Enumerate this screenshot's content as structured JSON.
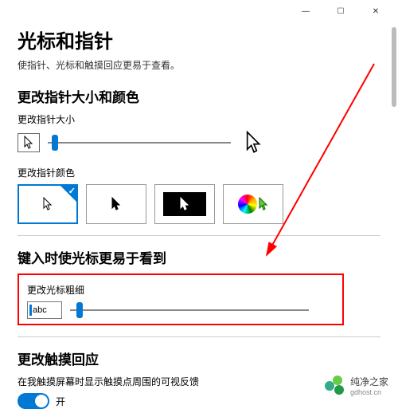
{
  "titlebar": {
    "min": "—",
    "max": "☐",
    "close": "✕"
  },
  "page": {
    "title": "光标和指针",
    "subtitle": "使指针、光标和触摸回应更易于查看。"
  },
  "pointer": {
    "section": "更改指针大小和颜色",
    "size_label": "更改指针大小",
    "color_label": "更改指针颜色"
  },
  "caret": {
    "section": "键入时使光标更易于看到",
    "thickness_label": "更改光标粗细",
    "preview_text": "abc"
  },
  "touch": {
    "section": "更改触摸回应",
    "desc": "在我触摸屏幕时显示触摸点周围的可视反馈",
    "state": "开"
  },
  "watermark": {
    "name": "纯净之家",
    "url": "gdhost.cn"
  }
}
